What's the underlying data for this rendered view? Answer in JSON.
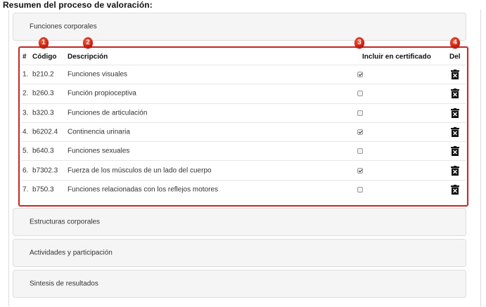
{
  "heading": "Resumen del proceso de valoración:",
  "panels": {
    "funciones": "Funciones corporales",
    "estructuras": "Estructuras corporales",
    "actividades": "Actividades y participación",
    "sintesis": "Sintesis de resultados"
  },
  "markers": [
    "1",
    "2",
    "3",
    "4"
  ],
  "table": {
    "headers": {
      "num": "#",
      "code": "Código",
      "desc": "Descripción",
      "cert": "Incluir en certificado",
      "del": "Del"
    },
    "rows": [
      {
        "num": "1.",
        "code": "b210.2",
        "desc": "Funciones visuales",
        "cert": true
      },
      {
        "num": "2.",
        "code": "b260.3",
        "desc": "Función propioceptiva",
        "cert": false
      },
      {
        "num": "3.",
        "code": "b320.3",
        "desc": "Funciones de articulación",
        "cert": false
      },
      {
        "num": "4.",
        "code": "b6202.4",
        "desc": "Continencia urinaria",
        "cert": true
      },
      {
        "num": "5.",
        "code": "b640.3",
        "desc": "Funciones sexuales",
        "cert": false
      },
      {
        "num": "6.",
        "code": "b7302.3",
        "desc": "Fuerza de los músculos de un lado del cuerpo",
        "cert": true
      },
      {
        "num": "7.",
        "code": "b750.3",
        "desc": "Funciones relacionadas con los reflejos motores",
        "cert": false
      }
    ]
  },
  "colors": {
    "highlight": "#e01f1f",
    "panel_bg": "#f5f5f5"
  },
  "icons": {
    "delete": "trash-icon",
    "marker": "numbered-marker"
  }
}
